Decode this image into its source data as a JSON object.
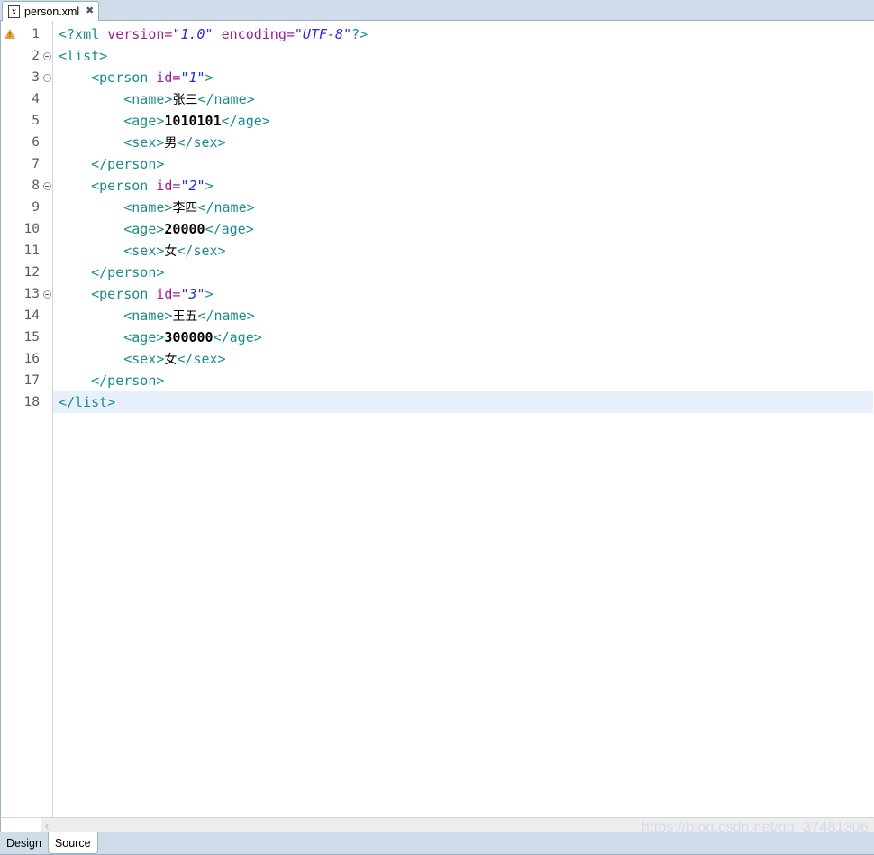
{
  "tab": {
    "file_icon_label": "X",
    "title": "person.xml",
    "close_label": "✖"
  },
  "markers": [
    {
      "line": 1,
      "type": "warning-icon"
    }
  ],
  "editor": {
    "line_numbers": [
      "1",
      "2",
      "3",
      "4",
      "5",
      "6",
      "7",
      "8",
      "9",
      "10",
      "11",
      "12",
      "13",
      "14",
      "15",
      "16",
      "17",
      "18"
    ],
    "fold_lines": [
      2,
      3,
      8,
      13
    ],
    "current_line": 18,
    "lines": [
      {
        "n": 1,
        "tokens": [
          {
            "t": "tag",
            "v": "<?xml "
          },
          {
            "t": "attr",
            "v": "version="
          },
          {
            "t": "val",
            "v": "\"1.0\""
          },
          {
            "t": "tag",
            "v": " "
          },
          {
            "t": "attr",
            "v": "encoding="
          },
          {
            "t": "val",
            "v": "\"UTF-8\""
          },
          {
            "t": "tag",
            "v": "?>"
          }
        ]
      },
      {
        "n": 2,
        "tokens": [
          {
            "t": "tag",
            "v": "<list>"
          }
        ]
      },
      {
        "n": 3,
        "tokens": [
          {
            "t": "plain",
            "v": "    "
          },
          {
            "t": "tag",
            "v": "<person "
          },
          {
            "t": "attr",
            "v": "id="
          },
          {
            "t": "val",
            "v": "\"1\""
          },
          {
            "t": "tag",
            "v": ">"
          }
        ]
      },
      {
        "n": 4,
        "tokens": [
          {
            "t": "plain",
            "v": "        "
          },
          {
            "t": "tag",
            "v": "<name>"
          },
          {
            "t": "cjk",
            "v": "张三"
          },
          {
            "t": "tag",
            "v": "</name>"
          }
        ]
      },
      {
        "n": 5,
        "tokens": [
          {
            "t": "plain",
            "v": "        "
          },
          {
            "t": "tag",
            "v": "<age>"
          },
          {
            "t": "text",
            "v": "1010101"
          },
          {
            "t": "tag",
            "v": "</age>"
          }
        ]
      },
      {
        "n": 6,
        "tokens": [
          {
            "t": "plain",
            "v": "        "
          },
          {
            "t": "tag",
            "v": "<sex>"
          },
          {
            "t": "cjk",
            "v": "男"
          },
          {
            "t": "tag",
            "v": "</sex>"
          }
        ]
      },
      {
        "n": 7,
        "tokens": [
          {
            "t": "plain",
            "v": "    "
          },
          {
            "t": "tag",
            "v": "</person>"
          }
        ]
      },
      {
        "n": 8,
        "tokens": [
          {
            "t": "plain",
            "v": "    "
          },
          {
            "t": "tag",
            "v": "<person "
          },
          {
            "t": "attr",
            "v": "id="
          },
          {
            "t": "val",
            "v": "\"2\""
          },
          {
            "t": "tag",
            "v": ">"
          }
        ]
      },
      {
        "n": 9,
        "tokens": [
          {
            "t": "plain",
            "v": "        "
          },
          {
            "t": "tag",
            "v": "<name>"
          },
          {
            "t": "cjk",
            "v": "李四"
          },
          {
            "t": "tag",
            "v": "</name>"
          }
        ]
      },
      {
        "n": 10,
        "tokens": [
          {
            "t": "plain",
            "v": "        "
          },
          {
            "t": "tag",
            "v": "<age>"
          },
          {
            "t": "text",
            "v": "20000"
          },
          {
            "t": "tag",
            "v": "</age>"
          }
        ]
      },
      {
        "n": 11,
        "tokens": [
          {
            "t": "plain",
            "v": "        "
          },
          {
            "t": "tag",
            "v": "<sex>"
          },
          {
            "t": "cjk",
            "v": "女"
          },
          {
            "t": "tag",
            "v": "</sex>"
          }
        ]
      },
      {
        "n": 12,
        "tokens": [
          {
            "t": "plain",
            "v": "    "
          },
          {
            "t": "tag",
            "v": "</person>"
          }
        ]
      },
      {
        "n": 13,
        "tokens": [
          {
            "t": "plain",
            "v": "    "
          },
          {
            "t": "tag",
            "v": "<person "
          },
          {
            "t": "attr",
            "v": "id="
          },
          {
            "t": "val",
            "v": "\"3\""
          },
          {
            "t": "tag",
            "v": ">"
          }
        ]
      },
      {
        "n": 14,
        "tokens": [
          {
            "t": "plain",
            "v": "        "
          },
          {
            "t": "tag",
            "v": "<name>"
          },
          {
            "t": "cjk",
            "v": "王五"
          },
          {
            "t": "tag",
            "v": "</name>"
          }
        ]
      },
      {
        "n": 15,
        "tokens": [
          {
            "t": "plain",
            "v": "        "
          },
          {
            "t": "tag",
            "v": "<age>"
          },
          {
            "t": "text",
            "v": "300000"
          },
          {
            "t": "tag",
            "v": "</age>"
          }
        ]
      },
      {
        "n": 16,
        "tokens": [
          {
            "t": "plain",
            "v": "        "
          },
          {
            "t": "tag",
            "v": "<sex>"
          },
          {
            "t": "cjk",
            "v": "女"
          },
          {
            "t": "tag",
            "v": "</sex>"
          }
        ]
      },
      {
        "n": 17,
        "tokens": [
          {
            "t": "plain",
            "v": "    "
          },
          {
            "t": "tag",
            "v": "</person>"
          }
        ]
      },
      {
        "n": 18,
        "tokens": [
          {
            "t": "tag",
            "v": "</list>"
          }
        ]
      }
    ]
  },
  "scrollbar": {
    "left_arrow": "‹"
  },
  "bottom_tabs": [
    {
      "label": "Design",
      "active": false
    },
    {
      "label": "Source",
      "active": true
    }
  ],
  "watermark": "https://blog.csdn.net/qq_37481306",
  "colors": {
    "tag": "#1b8c8c",
    "attribute": "#9b1f9b",
    "value": "#2a2ae0",
    "text": "#000000",
    "current_line_bg": "#e8f1fb",
    "tab_bar_bg": "#cfdcea",
    "warning": "#e8a33d"
  }
}
